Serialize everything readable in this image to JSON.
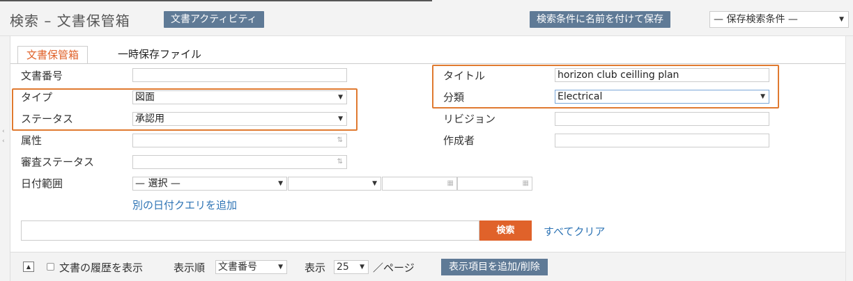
{
  "header": {
    "title": "検索 – 文書保管箱",
    "activity_button": "文書アクティビティ",
    "save_search_button": "検索条件に名前を付けて保存",
    "saved_searches_select": "— 保存検索条件 —"
  },
  "tabs": [
    {
      "label": "文書保管箱",
      "active": true
    },
    {
      "label": "一時保存ファイル",
      "active": false
    }
  ],
  "form": {
    "doc_number": {
      "label": "文書番号",
      "value": ""
    },
    "type": {
      "label": "タイプ",
      "value": "図面"
    },
    "status": {
      "label": "ステータス",
      "value": "承認用"
    },
    "attribute": {
      "label": "属性",
      "value": ""
    },
    "review_status": {
      "label": "審査ステータス",
      "value": ""
    },
    "date_range": {
      "label": "日付範囲",
      "select1": "— 選択 —",
      "select2": "",
      "from": "",
      "to": ""
    },
    "add_date_query": "別の日付クエリを追加",
    "title": {
      "label": "タイトル",
      "value": "horizon club ceilling plan"
    },
    "category": {
      "label": "分類",
      "value": "Electrical"
    },
    "revision": {
      "label": "リビジョン",
      "value": ""
    },
    "author": {
      "label": "作成者",
      "value": ""
    }
  },
  "search": {
    "input_value": "",
    "button": "検索",
    "clear_link": "すべてクリア"
  },
  "footer": {
    "show_history_label": "文書の履歴を表示",
    "show_history_checked": false,
    "sort_label": "表示順",
    "sort_value": "文書番号",
    "display_label": "表示",
    "page_size": "25",
    "per_page": "／ページ",
    "columns_button": "表示項目を追加/削除"
  },
  "colors": {
    "accent_orange": "#e0622a",
    "button_slate": "#5f7a96",
    "link_blue": "#2e74b5",
    "highlight": "#e07a30"
  }
}
